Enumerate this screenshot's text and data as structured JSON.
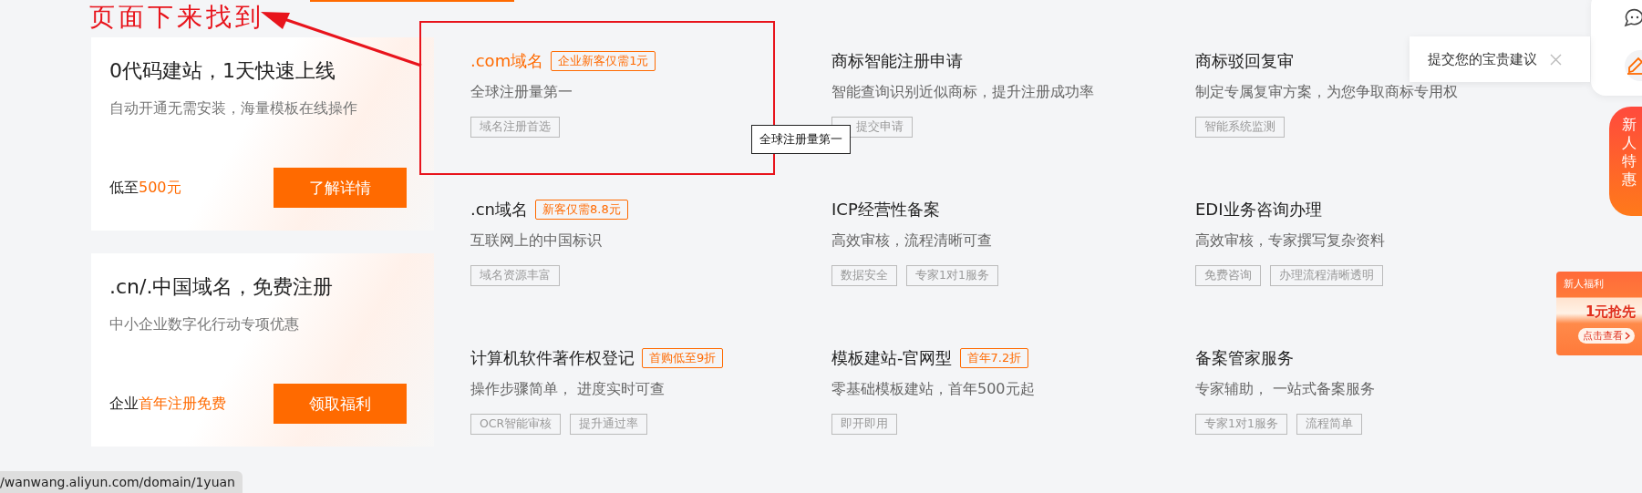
{
  "annotation": {
    "text": "页面下来找到"
  },
  "promo_cards": [
    {
      "title": "0代码建站，1天快速上线",
      "subtitle": "自动开通无需安装，海量模板在线操作",
      "price_prefix": "低至",
      "price_highlight": "500元",
      "button": "了解详情"
    },
    {
      "title": ".cn/.中国域名，免费注册",
      "subtitle": "中小企业数字化行动专项优惠",
      "price_prefix": "企业",
      "price_highlight": "首年注册免费",
      "button": "领取福利"
    }
  ],
  "products": [
    {
      "name": ".com域名",
      "highlighted": true,
      "badge": "企业新客仅需1元",
      "description": "全球注册量第一",
      "tags": [
        "域名注册首选"
      ]
    },
    {
      "name": "商标智能注册申请",
      "highlighted": false,
      "description": "智能查询识别近似商标，提升注册成功率",
      "tags": [
        "提交申请"
      ]
    },
    {
      "name": "商标驳回复审",
      "highlighted": false,
      "description": "制定专属复审方案，为您争取商标专用权",
      "tags": [
        "智能系统监测"
      ]
    },
    {
      "name": ".cn域名",
      "highlighted": false,
      "badge": "新客仅需8.8元",
      "description": "互联网上的中国标识",
      "tags": [
        "域名资源丰富"
      ]
    },
    {
      "name": "ICP经营性备案",
      "highlighted": false,
      "description": "高效审核，流程清晰可查",
      "tags": [
        "数据安全",
        "专家1对1服务"
      ]
    },
    {
      "name": "EDI业务咨询办理",
      "highlighted": false,
      "description": "高效审核，专家撰写复杂资料",
      "tags": [
        "免费咨询",
        "办理流程清晰透明"
      ]
    },
    {
      "name": "计算机软件著作权登记",
      "highlighted": false,
      "badge": "首购低至9折",
      "description": "操作步骤简单， 进度实时可查",
      "tags": [
        "OCR智能审核",
        "提升通过率"
      ]
    },
    {
      "name": "模板建站-官网型",
      "highlighted": false,
      "badge": "首年7.2折",
      "description": "零基础模板建站，首年500元起",
      "tags": [
        "即开即用"
      ]
    },
    {
      "name": "备案管家服务",
      "highlighted": false,
      "description": "专家辅助， 一站式备案服务",
      "tags": [
        "专家1对1服务",
        "流程简单"
      ]
    }
  ],
  "tooltip": {
    "text": "全球注册量第一"
  },
  "feedback_popover": {
    "text": "提交您的宝贵建议"
  },
  "side_tab": {
    "text": "新人特惠"
  },
  "promo_widget": {
    "title": "新人福利",
    "headline": "1元抢先",
    "action": "点击查看"
  },
  "status_url": "/wanwang.aliyun.com/domain/1yuan"
}
